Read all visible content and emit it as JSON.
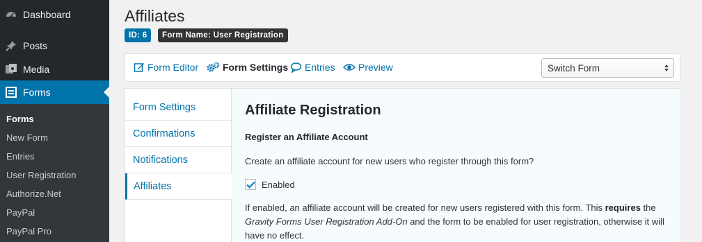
{
  "sidebar": {
    "menu": [
      {
        "label": "Dashboard",
        "icon": "dashboard-icon"
      },
      {
        "label": "Posts",
        "icon": "pin-icon"
      },
      {
        "label": "Media",
        "icon": "media-icon"
      },
      {
        "label": "Forms",
        "icon": "forms-icon",
        "current": true
      }
    ],
    "submenu": [
      "Forms",
      "New Form",
      "Entries",
      "User Registration",
      "Authorize.Net",
      "PayPal",
      "PayPal Pro"
    ]
  },
  "header": {
    "title": "Affiliates",
    "id_badge": "ID: 6",
    "form_name_badge": "Form Name: User Registration"
  },
  "toolbar": {
    "form_editor": "Form Editor",
    "form_settings": "Form Settings",
    "entries": "Entries",
    "preview": "Preview",
    "switch_form": "Switch Form"
  },
  "settings_tabs": [
    "Form Settings",
    "Confirmations",
    "Notifications",
    "Affiliates"
  ],
  "content": {
    "heading": "Affiliate Registration",
    "section_title": "Register an Affiliate Account",
    "question": "Create an affiliate account for new users who register through this form?",
    "checkbox_label": "Enabled",
    "checkbox_checked": true,
    "desc_part1": "If enabled, an affiliate account will be created for new users registered with this form. This ",
    "desc_bold": "requires",
    "desc_part2": " the ",
    "desc_italic": "Gravity Forms User Registration Add-On",
    "desc_part3": " and the form to be enabled for user registration, otherwise it will have no effect."
  },
  "colors": {
    "sidebar_bg": "#23282d",
    "submenu_bg": "#32373c",
    "accent": "#0073aa"
  }
}
